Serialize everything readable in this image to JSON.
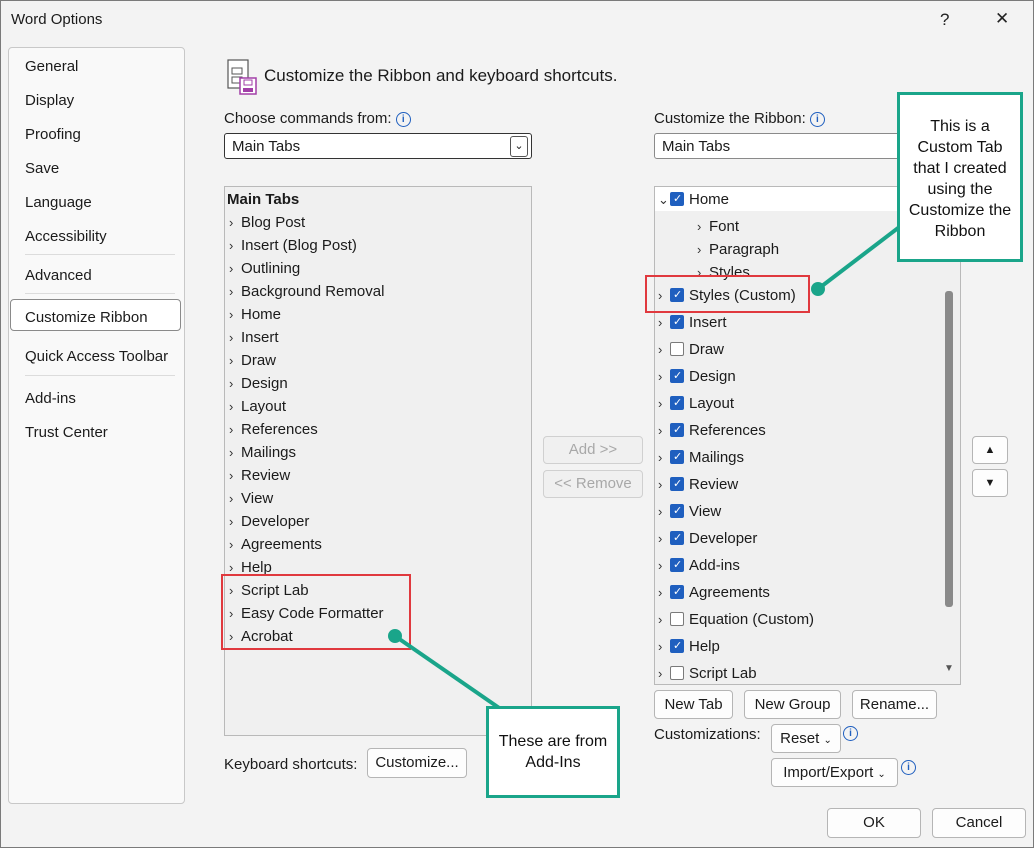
{
  "window": {
    "title": "Word Options",
    "help": "?",
    "close": "✕"
  },
  "sidebar": {
    "items": [
      "General",
      "Display",
      "Proofing",
      "Save",
      "Language",
      "Accessibility",
      "Advanced",
      "Customize Ribbon",
      "Quick Access Toolbar",
      "Add-ins",
      "Trust Center"
    ],
    "selected": "Customize Ribbon"
  },
  "header": {
    "title": "Customize the Ribbon and keyboard shortcuts."
  },
  "left": {
    "label": "Choose commands from:",
    "combo_value": "Main Tabs",
    "list_header": "Main Tabs",
    "items": [
      "Blog Post",
      "Insert (Blog Post)",
      "Outlining",
      "Background Removal",
      "Home",
      "Insert",
      "Draw",
      "Design",
      "Layout",
      "References",
      "Mailings",
      "Review",
      "View",
      "Developer",
      "Agreements",
      "Help",
      "Script Lab",
      "Easy Code Formatter",
      "Acrobat"
    ]
  },
  "middle": {
    "add": "Add >>",
    "remove": "<< Remove"
  },
  "right": {
    "label": "Customize the Ribbon:",
    "combo_value": "Main Tabs",
    "home": {
      "label": "Home",
      "checked": true,
      "groups": [
        "Font",
        "Paragraph",
        "Styles"
      ]
    },
    "items": [
      {
        "label": "Styles (Custom)",
        "checked": true
      },
      {
        "label": "Insert",
        "checked": true
      },
      {
        "label": "Draw",
        "checked": false
      },
      {
        "label": "Design",
        "checked": true
      },
      {
        "label": "Layout",
        "checked": true
      },
      {
        "label": "References",
        "checked": true
      },
      {
        "label": "Mailings",
        "checked": true
      },
      {
        "label": "Review",
        "checked": true
      },
      {
        "label": "View",
        "checked": true
      },
      {
        "label": "Developer",
        "checked": true
      },
      {
        "label": "Add-ins",
        "checked": true
      },
      {
        "label": "Agreements",
        "checked": true
      },
      {
        "label": "Equation (Custom)",
        "checked": false
      },
      {
        "label": "Help",
        "checked": true
      },
      {
        "label": "Script Lab",
        "checked": false
      }
    ],
    "new_tab": "New Tab",
    "new_group": "New Group",
    "rename": "Rename...",
    "customizations_label": "Customizations:",
    "reset": "Reset",
    "import_export": "Import/Export"
  },
  "keyboard": {
    "label": "Keyboard shortcuts:",
    "button": "Customize..."
  },
  "footer": {
    "ok": "OK",
    "cancel": "Cancel"
  },
  "callouts": {
    "custom_tab": "This is a Custom Tab that I created using the Customize the Ribbon",
    "addins": "These are from Add-Ins"
  },
  "colors": {
    "accent": "#1f5fbf",
    "callout_border": "#1aa58a",
    "highlight": "#e0393e"
  }
}
